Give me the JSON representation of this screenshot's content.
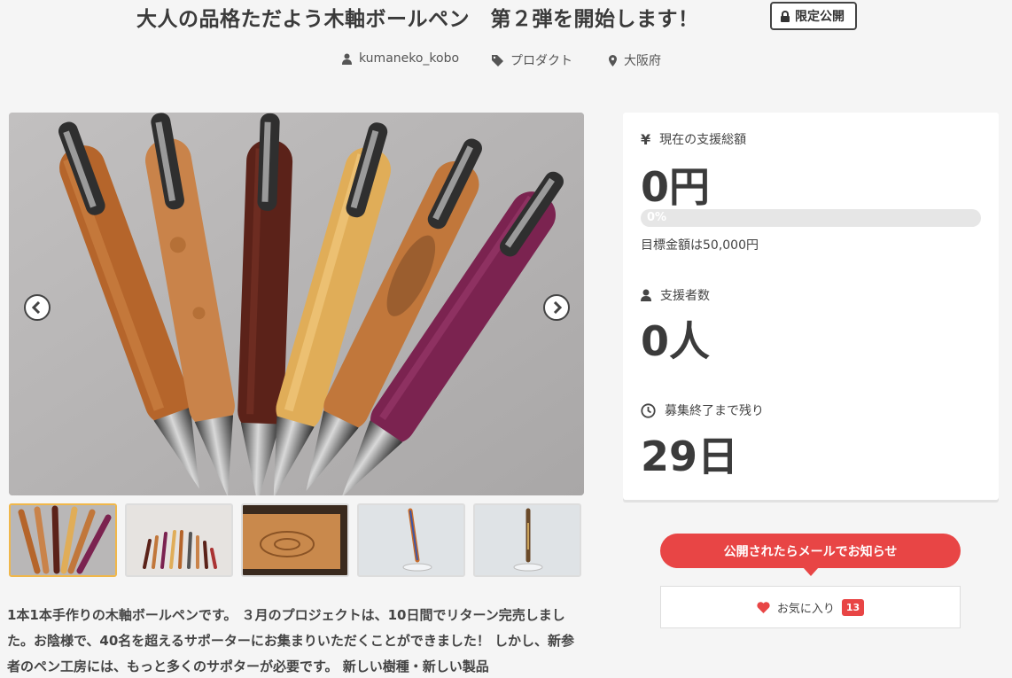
{
  "project": {
    "title": "大人の品格ただよう木軸ボールペン　第２弾を開始します！",
    "badge": "限定公開",
    "owner": "kumaneko_kobo",
    "category": "プロダクト",
    "location": "大阪府"
  },
  "gallery": {
    "total_images": 5,
    "active_index": 0
  },
  "stats": {
    "raised_label": "現在の支援総額",
    "raised_value": "0円",
    "progress_text": "0%",
    "progress_fraction": 0,
    "goal_text": "目標金額は50,000円",
    "backers_label": "支援者数",
    "backers_value": "0人",
    "remaining_label": "募集終了まで残り",
    "remaining_value": "29日"
  },
  "actions": {
    "notify_label": "公開されたらメールでお知らせ",
    "favorite_label": "お気に入り",
    "favorite_count": "13"
  },
  "description": "1本1本手作りの木軸ボールペンです。 ３月のプロジェクトは、10日間でリターン完売しました。お陰様で、40名を超えるサポーターにお集まりいただくことができました！ しかし、新参者のペン工房には、もっと多くのサポターが必要です。 新しい樹種・新しい製品",
  "icons": {
    "user": "user-icon",
    "tag": "tag-icon",
    "location": "map-pin-icon",
    "lock": "lock-icon",
    "yen": "yen-icon",
    "clock": "clock-icon",
    "heart": "heart-icon",
    "prev": "chevron-left-icon",
    "next": "chevron-right-icon"
  },
  "colors": {
    "accent": "#e84545",
    "thumb_active_border": "#f0b74a",
    "text": "#3a3a3a"
  }
}
